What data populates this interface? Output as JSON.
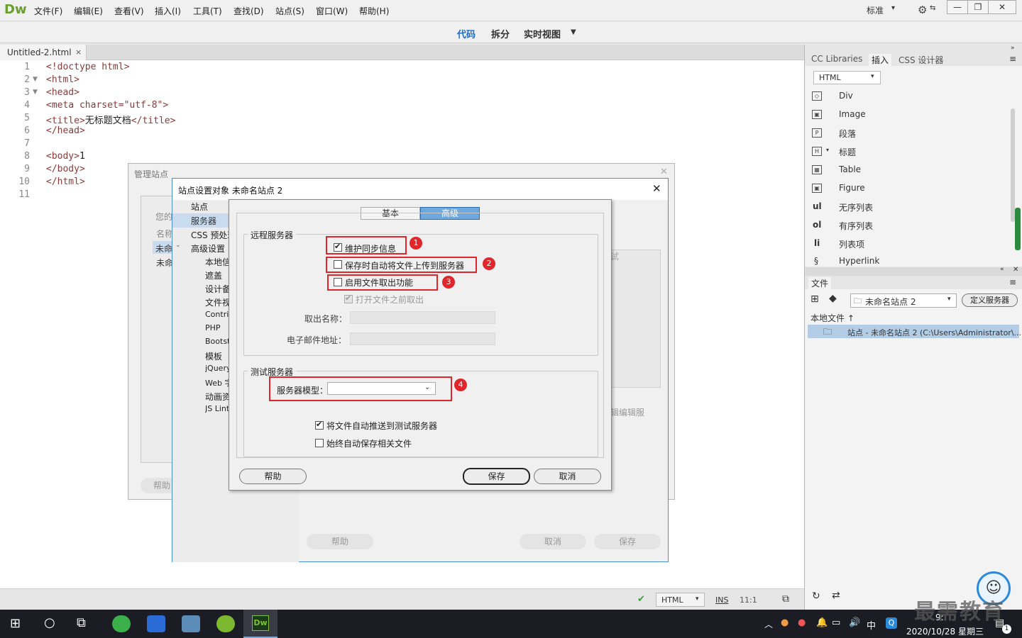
{
  "app": {
    "logo": "Dw",
    "menu": [
      "文件(F)",
      "编辑(E)",
      "查看(V)",
      "插入(I)",
      "工具(T)",
      "查找(D)",
      "站点(S)",
      "窗口(W)",
      "帮助(H)"
    ],
    "workspace": "标准",
    "view_tabs": [
      "代码",
      "拆分",
      "实时视图"
    ]
  },
  "document": {
    "tab_name": "Untitled-2.html",
    "tab_close": "×",
    "lines": [
      {
        "n": "1",
        "code": "<!doctype html>"
      },
      {
        "n": "2",
        "code": "<html>"
      },
      {
        "n": "3",
        "code": "<head>"
      },
      {
        "n": "4",
        "code": "<meta charset=\"utf-8\">"
      },
      {
        "n": "5",
        "tag1": "<title>",
        "text": "无标题文档",
        "tag2": "</title>"
      },
      {
        "n": "6",
        "code": "</head>"
      },
      {
        "n": "7",
        "code": ""
      },
      {
        "n": "8",
        "tag1": "<body>",
        "text": "1"
      },
      {
        "n": "9",
        "code": "</body>"
      },
      {
        "n": "10",
        "code": "</html>"
      },
      {
        "n": "11",
        "code": ""
      }
    ]
  },
  "statusbar": {
    "language": "HTML",
    "mode": "INS",
    "position": "11:1"
  },
  "right_panel": {
    "tabs": [
      "CC Libraries",
      "插入",
      "CSS 设计器"
    ],
    "category": "HTML",
    "insert_items": [
      {
        "icon": "div-icon",
        "glyph": "◇",
        "label": "Div"
      },
      {
        "icon": "image-icon",
        "glyph": "▣",
        "label": "Image"
      },
      {
        "icon": "paragraph-icon",
        "glyph": "P",
        "label": "段落"
      },
      {
        "icon": "heading-icon",
        "glyph": "H",
        "label": "标题"
      },
      {
        "icon": "table-icon",
        "glyph": "▦",
        "label": "Table"
      },
      {
        "icon": "figure-icon",
        "glyph": "▣",
        "label": "Figure"
      },
      {
        "icon": "ul-icon",
        "glyph": "ul",
        "label": "无序列表"
      },
      {
        "icon": "ol-icon",
        "glyph": "ol",
        "label": "有序列表"
      },
      {
        "icon": "li-icon",
        "glyph": "li",
        "label": "列表项"
      },
      {
        "icon": "hyperlink-icon",
        "glyph": "§",
        "label": "Hyperlink"
      }
    ],
    "files_title": "文件",
    "site_select": "未命名站点 2",
    "define_server": "定义服务器",
    "local_files": "本地文件 ↑",
    "site_row": "站点 - 未命名站点 2 (C:\\Users\\Administrator\\..."
  },
  "manage_sites": {
    "title": "管理站点",
    "partial": [
      "您的",
      "名称",
      "未命",
      "未命"
    ],
    "partial_right": [
      "试",
      "辑编辑服"
    ],
    "help": "帮助"
  },
  "site_setup": {
    "title": "站点设置对象 未命名站点 2",
    "categories": [
      "站点",
      "服务器",
      "CSS 预处理器",
      "高级设置",
      "本地信息",
      "遮盖",
      "设计备注",
      "文件视图列",
      "Contribute",
      "PHP",
      "Bootstrap",
      "模板",
      "jQuery",
      "Web 字体",
      "动画资源",
      "JS Lint"
    ],
    "help": "帮助",
    "cancel": "取消",
    "save": "保存"
  },
  "advanced": {
    "tabs": [
      "基本",
      "高级"
    ],
    "remote_group": "远程服务器",
    "opt_sync": "维护同步信息",
    "opt_upload": "保存时自动将文件上传到服务器",
    "opt_checkout": "启用文件取出功能",
    "opt_before": "打开文件之前取出",
    "checkout_name": "取出名称：",
    "email": "电子邮件地址：",
    "test_group": "测试服务器",
    "server_model": "服务器模型：",
    "opt_push": "将文件自动推送到测试服务器",
    "opt_save": "始终自动保存相关文件",
    "help": "帮助",
    "save": "保存",
    "cancel": "取消",
    "badges": [
      "1",
      "2",
      "3",
      "4"
    ]
  },
  "taskbar": {
    "ime": "中",
    "time": "9:",
    "date": "2020/10/28 星期三",
    "notif": "1",
    "watermark": "最需教育"
  }
}
